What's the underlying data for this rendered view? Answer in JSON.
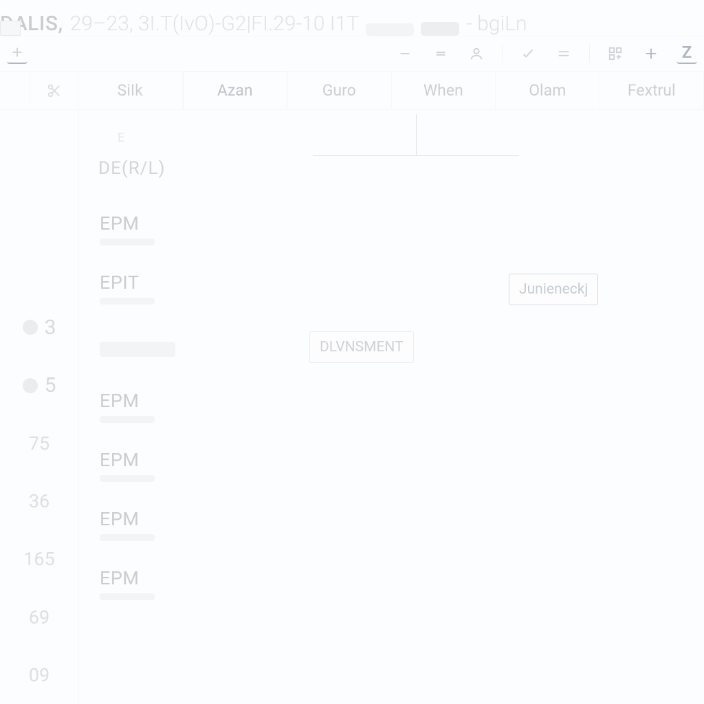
{
  "title": {
    "name": "DALIS,",
    "meta": "29–23, 3I.T(IvO)-G2|FI.29-10 I1T",
    "suffix": "- bgiLn"
  },
  "toolbar_icons": {
    "add_tab": "plus",
    "minus": "minus",
    "equals": "equals",
    "user": "user",
    "check": "check",
    "lines": "lines",
    "layout": "layout",
    "plus": "plus-bold",
    "z": "Z"
  },
  "tabs": [
    {
      "label": "SiIk"
    },
    {
      "label": "Azan",
      "active": true
    },
    {
      "label": "Guro"
    },
    {
      "label": "When"
    },
    {
      "label": "Olam"
    },
    {
      "label": "Fextrul"
    }
  ],
  "side_hint": "E",
  "lead_label": "DE(R/L)",
  "rows": [
    {
      "num": "",
      "label": "EPM"
    },
    {
      "num": "3",
      "label": "EPIT",
      "dot": true
    },
    {
      "num": "5",
      "label": "",
      "dot": true,
      "blob": true
    },
    {
      "num": "75",
      "label": "EPM"
    },
    {
      "num": "36",
      "label": "EPM"
    },
    {
      "num": "165",
      "label": "EPM"
    },
    {
      "num": "69",
      "label": "EPM"
    },
    {
      "num": "09",
      "label": ""
    }
  ],
  "chips": {
    "center": "DLVNSMENT",
    "right": "Junieneckj"
  }
}
